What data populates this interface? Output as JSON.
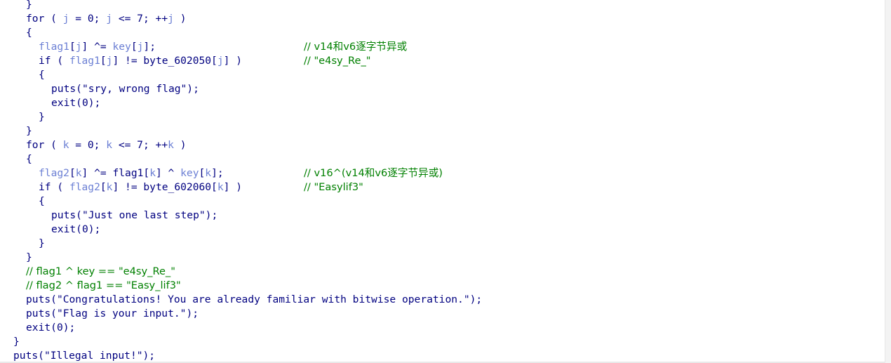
{
  "editor": {
    "lines": [
      {
        "indent": 0,
        "tokens": [
          {
            "t": "}",
            "c": "op"
          }
        ]
      },
      {
        "indent": 0,
        "tokens": [
          {
            "t": "for",
            "c": "kw"
          },
          {
            "t": " ( ",
            "c": "op"
          },
          {
            "t": "j",
            "c": "var"
          },
          {
            "t": " = 0; ",
            "c": "op"
          },
          {
            "t": "j",
            "c": "var"
          },
          {
            "t": " <= 7; ++",
            "c": "op"
          },
          {
            "t": "j",
            "c": "var"
          },
          {
            "t": " )",
            "c": "op"
          }
        ]
      },
      {
        "indent": 0,
        "tokens": [
          {
            "t": "{",
            "c": "op"
          }
        ]
      },
      {
        "indent": 1,
        "tokens": [
          {
            "t": "flag1",
            "c": "var"
          },
          {
            "t": "[",
            "c": "op"
          },
          {
            "t": "j",
            "c": "var"
          },
          {
            "t": "] ^= ",
            "c": "op"
          },
          {
            "t": "key",
            "c": "var"
          },
          {
            "t": "[",
            "c": "op"
          },
          {
            "t": "j",
            "c": "var"
          },
          {
            "t": "];",
            "c": "op"
          }
        ],
        "comment": "// v14和v6逐字节异或"
      },
      {
        "indent": 1,
        "tokens": [
          {
            "t": "if",
            "c": "kw"
          },
          {
            "t": " ( ",
            "c": "op"
          },
          {
            "t": "flag1",
            "c": "var"
          },
          {
            "t": "[",
            "c": "op"
          },
          {
            "t": "j",
            "c": "var"
          },
          {
            "t": "] != byte_602050[",
            "c": "op"
          },
          {
            "t": "j",
            "c": "var"
          },
          {
            "t": "] )",
            "c": "op"
          }
        ],
        "comment": "// \"e4sy_Re_\""
      },
      {
        "indent": 1,
        "tokens": [
          {
            "t": "{",
            "c": "op"
          }
        ]
      },
      {
        "indent": 2,
        "tokens": [
          {
            "t": "puts",
            "c": "fn"
          },
          {
            "t": "(\"sry, wrong flag\");",
            "c": "str"
          }
        ]
      },
      {
        "indent": 2,
        "tokens": [
          {
            "t": "exit",
            "c": "fn"
          },
          {
            "t": "(0);",
            "c": "op"
          }
        ]
      },
      {
        "indent": 1,
        "tokens": [
          {
            "t": "}",
            "c": "op"
          }
        ]
      },
      {
        "indent": 0,
        "tokens": [
          {
            "t": "}",
            "c": "op"
          }
        ]
      },
      {
        "indent": 0,
        "tokens": [
          {
            "t": "for",
            "c": "kw"
          },
          {
            "t": " ( ",
            "c": "op"
          },
          {
            "t": "k",
            "c": "var"
          },
          {
            "t": " = 0; ",
            "c": "op"
          },
          {
            "t": "k",
            "c": "var"
          },
          {
            "t": " <= 7; ++",
            "c": "op"
          },
          {
            "t": "k",
            "c": "var"
          },
          {
            "t": " )",
            "c": "op"
          }
        ]
      },
      {
        "indent": 0,
        "tokens": [
          {
            "t": "{",
            "c": "op"
          }
        ]
      },
      {
        "indent": 1,
        "tokens": [
          {
            "t": "flag2",
            "c": "var"
          },
          {
            "t": "[",
            "c": "op"
          },
          {
            "t": "k",
            "c": "var"
          },
          {
            "t": "] ^= flag1[",
            "c": "op"
          },
          {
            "t": "k",
            "c": "var"
          },
          {
            "t": "] ^ ",
            "c": "op"
          },
          {
            "t": "key",
            "c": "var"
          },
          {
            "t": "[",
            "c": "op"
          },
          {
            "t": "k",
            "c": "var"
          },
          {
            "t": "];",
            "c": "op"
          }
        ],
        "comment": "// v16^(v14和v6逐字节异或)"
      },
      {
        "indent": 1,
        "tokens": [
          {
            "t": "if",
            "c": "kw"
          },
          {
            "t": " ( ",
            "c": "op"
          },
          {
            "t": "flag2",
            "c": "var"
          },
          {
            "t": "[",
            "c": "op"
          },
          {
            "t": "k",
            "c": "var"
          },
          {
            "t": "] != byte_602060[",
            "c": "op"
          },
          {
            "t": "k",
            "c": "var"
          },
          {
            "t": "] )",
            "c": "op"
          }
        ],
        "comment": "// \"Easylif3\""
      },
      {
        "indent": 1,
        "tokens": [
          {
            "t": "{",
            "c": "op"
          }
        ]
      },
      {
        "indent": 2,
        "tokens": [
          {
            "t": "puts",
            "c": "fn"
          },
          {
            "t": "(\"Just one last step\");",
            "c": "str"
          }
        ]
      },
      {
        "indent": 2,
        "tokens": [
          {
            "t": "exit",
            "c": "fn"
          },
          {
            "t": "(0);",
            "c": "op"
          }
        ]
      },
      {
        "indent": 1,
        "tokens": [
          {
            "t": "}",
            "c": "op"
          }
        ]
      },
      {
        "indent": 0,
        "tokens": [
          {
            "t": "}",
            "c": "op"
          }
        ]
      },
      {
        "indent": 0,
        "tokens": [
          {
            "t": "// flag1 ^ key == \"e4sy_Re_\"",
            "c": "cmt"
          }
        ]
      },
      {
        "indent": 0,
        "tokens": [
          {
            "t": "// flag2 ^ flag1 == \"Easy_lif3\"",
            "c": "cmt"
          }
        ]
      },
      {
        "indent": 0,
        "tokens": [
          {
            "t": "puts",
            "c": "fn"
          },
          {
            "t": "(\"Congratulations! You are already familiar with bitwise operation.\");",
            "c": "str"
          }
        ]
      },
      {
        "indent": 0,
        "tokens": [
          {
            "t": "puts",
            "c": "fn"
          },
          {
            "t": "(\"Flag is your input.\");",
            "c": "str"
          }
        ]
      },
      {
        "indent": 0,
        "tokens": [
          {
            "t": "exit",
            "c": "fn"
          },
          {
            "t": "(0);",
            "c": "op"
          }
        ]
      },
      {
        "indent": -1,
        "tokens": [
          {
            "t": "}",
            "c": "op"
          }
        ]
      },
      {
        "indent": -1,
        "tokens": [
          {
            "t": "puts",
            "c": "fn"
          },
          {
            "t": "(\"Illegal input!\");",
            "c": "str"
          }
        ]
      }
    ]
  },
  "colors": {
    "keyword": "#000080",
    "variable": "#6b7fd4",
    "comment": "#008000",
    "background": "#ffffff"
  }
}
